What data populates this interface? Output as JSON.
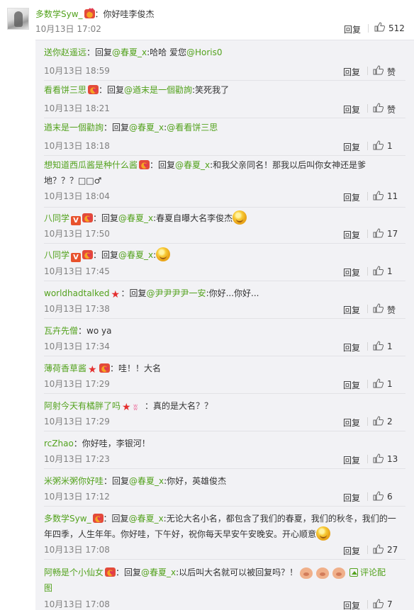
{
  "main_comment": {
    "author": "多数学Syw_",
    "text": "：你好哇李俊杰",
    "time": "10月13日 17:02",
    "reply_label": "回复",
    "likes": "512"
  },
  "reply_label": "回复",
  "replies": [
    {
      "author": "送你赵遥远",
      "pre": "：回复",
      "at": "@春夏_x",
      "post": ":哈哈 爱您",
      "at2": "@Horis0",
      "time": "10月13日 18:59",
      "likes": "赞"
    },
    {
      "author": "看看饼三思",
      "pre": "：回复",
      "at": "@遒末是一個勸詢",
      "post": ":笑死我了",
      "time": "10月13日 18:21",
      "likes": "赞"
    },
    {
      "author": "遒末是一個勸詢",
      "pre": "：回复",
      "at": "@春夏_x",
      "post": ":",
      "at2": "@看看饼三思",
      "time": "10月13日 18:18",
      "likes": "1"
    },
    {
      "author": "想知道西瓜酱是种什么酱",
      "pre": "：回复",
      "at": "@春夏_x",
      "post": ":和我父亲同名！那我以后叫你女神还是爹",
      "post_line2": "地？？？□□♂",
      "time": "10月13日 18:04",
      "likes": "11"
    },
    {
      "author": "八同学",
      "pre": "：回复",
      "at": "@春夏_x",
      "post": ":春夏自曝大名李俊杰",
      "time": "10月13日 17:50",
      "likes": "17"
    },
    {
      "author": "八同学",
      "pre": "：回复",
      "at": "@春夏_x",
      "post": ":",
      "time": "10月13日 17:45",
      "likes": "1"
    },
    {
      "author": "worldhadtalked",
      "pre": "：回复",
      "at": "@尹尹尹尹一安",
      "post": ":你好...你好...",
      "time": "10月13日 17:38",
      "likes": "赞"
    },
    {
      "author": "瓦卉先僧",
      "post": "：wo ya",
      "time": "10月13日 17:34",
      "likes": "1"
    },
    {
      "author": "薄荷香草酱",
      "post": "：哇！！大名",
      "time": "10月13日 17:29",
      "likes": "1"
    },
    {
      "author": "阿射今天有橘胖了吗",
      "post": "：真的是大名？？",
      "time": "10月13日 17:29",
      "likes": "2"
    },
    {
      "author": "rcZhao",
      "post": "：你好哇，李银河！",
      "time": "10月13日 17:23",
      "likes": "13"
    },
    {
      "author": "米粥米粥你好哇",
      "pre": "：回复",
      "at": "@春夏_x",
      "post": ":你好，英雄俊杰",
      "time": "10月13日 17:12",
      "likes": "6"
    },
    {
      "author": "多数学Syw_",
      "pre": "：回复",
      "at": "@春夏_x",
      "post": ":无论大名小名，都包含了我们的春夏，我们的秋冬，我们的一",
      "post_line2": "年四季，人生年年。你好哇，下午好，祝你每天早安午安晚安。开心顺意",
      "time": "10月13日 17:08",
      "likes": "27"
    },
    {
      "author": "阿畅是个小仙女",
      "pre": "：回复",
      "at": "@春夏_x",
      "post": ":以后叫大名就可以被回复吗？！",
      "link": "评论配",
      "link_line2": "图",
      "time": "10月13日 17:08",
      "likes": "7"
    }
  ],
  "colors": {
    "name": "#53a21d",
    "meta": "#808080",
    "panel": "#f2f2f5"
  },
  "icons": {
    "like": "thumbs-up-icon",
    "medal": "medal-badge-icon",
    "vip": "vip-v-icon",
    "star": "red-star-icon"
  }
}
